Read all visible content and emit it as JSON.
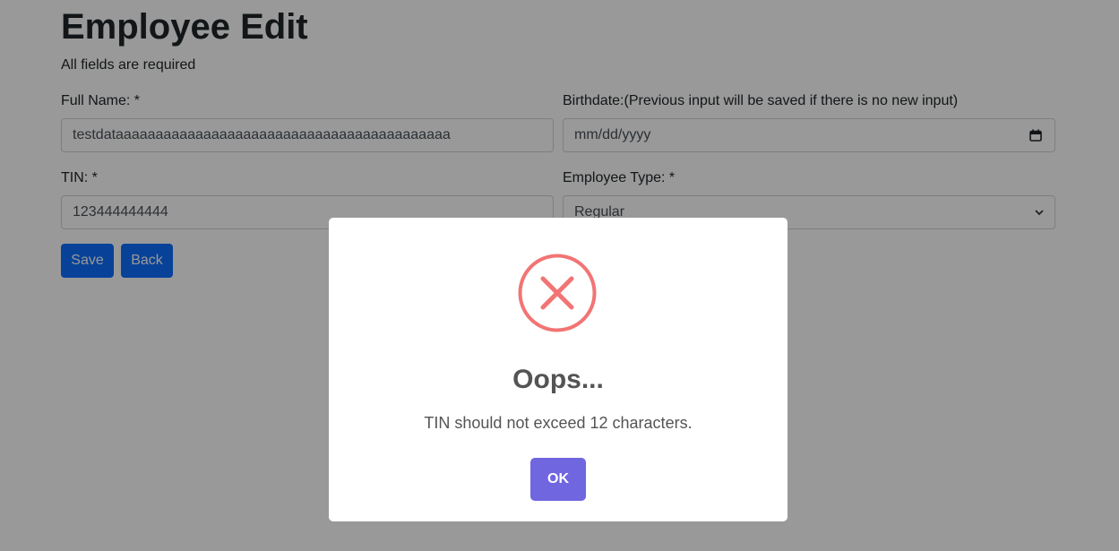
{
  "page": {
    "title": "Employee Edit",
    "subtitle": "All fields are required"
  },
  "form": {
    "full_name": {
      "label": "Full Name: *",
      "value": "testdataaaaaaaaaaaaaaaaaaaaaaaaaaaaaaaaaaaaaaaaaa"
    },
    "birthdate": {
      "label": "Birthdate:(Previous input will be saved if there is no new input)",
      "value": "mm/dd/yyyy"
    },
    "tin": {
      "label": "TIN: *",
      "value": "123444444444"
    },
    "employee_type": {
      "label": "Employee Type: *",
      "selected": "Regular"
    },
    "save_label": "Save",
    "back_label": "Back"
  },
  "dialog": {
    "icon": "error-x-icon",
    "title": "Oops...",
    "message": "TIN should not exceed 12 characters.",
    "ok_label": "OK"
  },
  "colors": {
    "primary_button": "#0d6efd",
    "dialog_confirm": "#7066e0",
    "error_icon": "#f27474",
    "overlay": "rgba(0,0,0,0.4)"
  }
}
